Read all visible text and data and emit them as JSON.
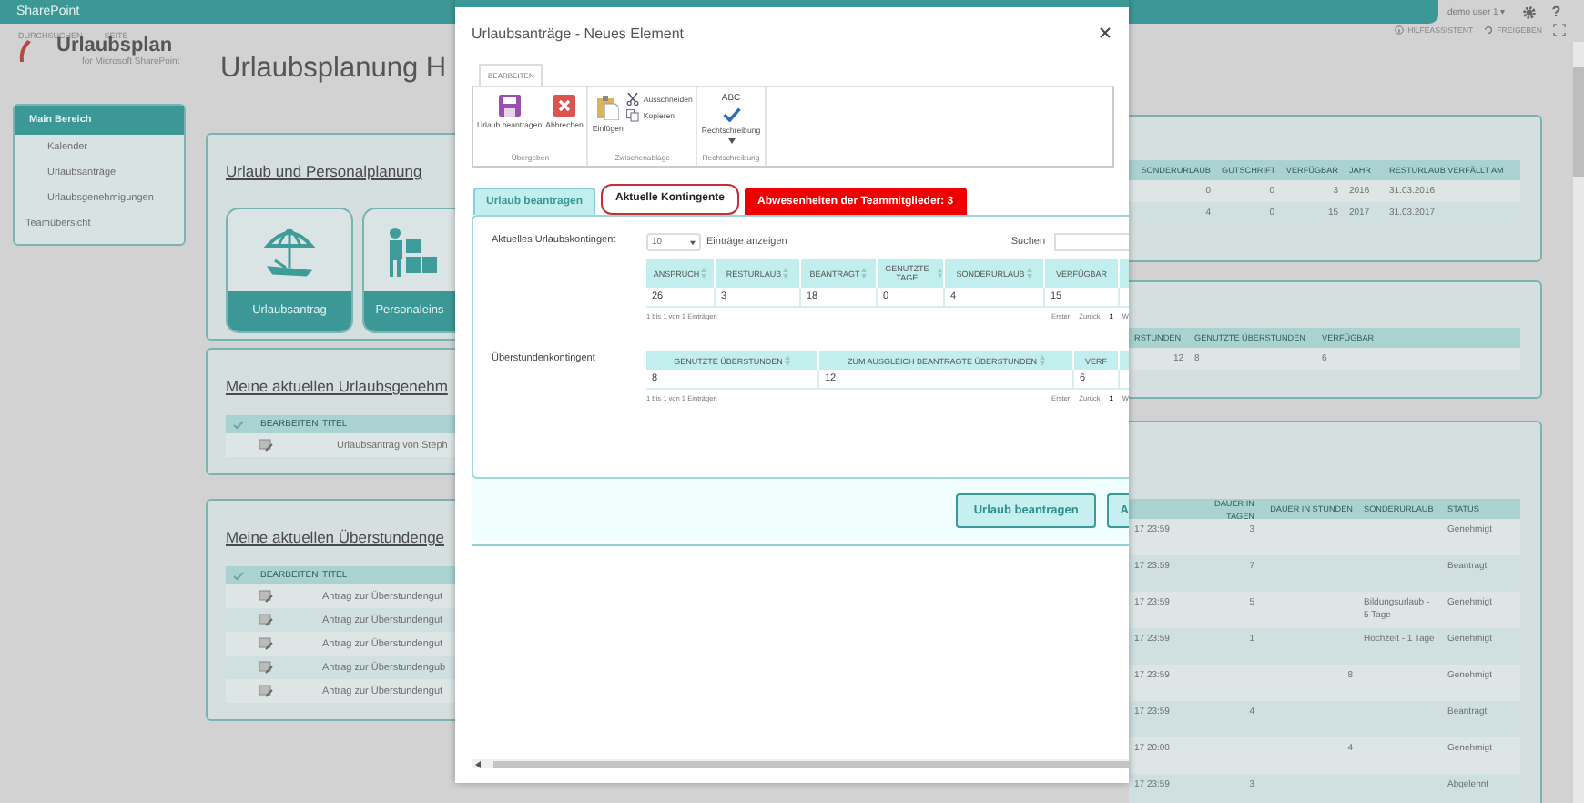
{
  "top_bar": {
    "brand": "SharePoint",
    "user": "demo user 1 ▾",
    "help": "?"
  },
  "sub_bar": {
    "links": [
      "DURCHSUCHEN",
      "SEITE"
    ],
    "actions": [
      {
        "label": "HILFEASSISTENT",
        "kind": "info"
      },
      {
        "label": "FREIGEBEN",
        "kind": "share"
      }
    ]
  },
  "logo": {
    "name": "Urlaubsplan",
    "subtitle": "for Microsoft SharePoint"
  },
  "page_title": "Urlaubsplanung H",
  "nav": {
    "items": [
      {
        "label": "Main Bereich",
        "selected": true,
        "children": [
          {
            "label": "Kalender",
            "selected": false
          },
          {
            "label": "Urlaubsanträge",
            "selected": false
          },
          {
            "label": "Urlaubsgenehmigungen",
            "selected": false
          }
        ]
      },
      {
        "label": "Teamübersicht",
        "selected": false
      }
    ]
  },
  "planning": {
    "title": "Urlaub und Personalplanung",
    "tiles": [
      {
        "label": "Urlaubsantrag",
        "kind": "vacation"
      },
      {
        "label": "Personaleins",
        "kind": "staff"
      }
    ]
  },
  "approvals": {
    "title": "Meine aktuellen Urlaubsgenehm",
    "columns": [
      "BEARBEITEN",
      "TITEL"
    ],
    "rows": [
      {
        "title": "Urlaubsantrag von Steph"
      }
    ]
  },
  "overtime": {
    "title": "Meine aktuellen Überstundenge",
    "columns": [
      "BEARBEITEN",
      "TITEL"
    ],
    "rows": [
      {
        "title": "Antrag zur Überstundengut"
      },
      {
        "title": "Antrag zur Überstundengut"
      },
      {
        "title": "Antrag zur Überstundengut"
      },
      {
        "title": "Antrag zur Überstundengub"
      },
      {
        "title": "Antrag zur Überstundengut"
      }
    ]
  },
  "balance": {
    "columns": [
      "SONDERURLAUB",
      "GUTSCHRIFT",
      "VERFÜGBAR",
      "JAHR",
      "RESTURLAUB VERFÄLLT AM"
    ],
    "rows": [
      [
        "0",
        "0",
        "3",
        "2016",
        "31.03.2016"
      ],
      [
        "4",
        "0",
        "15",
        "2017",
        "31.03.2017"
      ]
    ]
  },
  "overtime_balance": {
    "columns": [
      "RSTUNDEN",
      "GENUTZTE ÜBERSTUNDEN",
      "VERFÜGBAR"
    ],
    "rows": [
      [
        "12",
        "8",
        "6"
      ]
    ]
  },
  "requests": {
    "columns": [
      "",
      "DAUER IN TAGEN",
      "DAUER IN STUNDEN",
      "SONDERURLAUB",
      "STATUS"
    ],
    "rows": [
      [
        "17 23:59",
        "3",
        "",
        "",
        "Genehmigt"
      ],
      [
        "17 23:59",
        "7",
        "",
        "",
        "Beantragt"
      ],
      [
        "17 23:59",
        "5",
        "",
        "Bildungsurlaub - 5 Tage",
        "Genehmigt"
      ],
      [
        "17 23:59",
        "1",
        "",
        "Hochzeit - 1 Tage",
        "Genehmigt"
      ],
      [
        "17 23:59",
        "",
        "8",
        "",
        "Genehmigt"
      ],
      [
        "17 23:59",
        "4",
        "",
        "",
        "Beantragt"
      ],
      [
        "17 20:00",
        "",
        "4",
        "",
        "Genehmigt"
      ],
      [
        "17 23:59",
        "3",
        "",
        "",
        "Abgelehnt"
      ]
    ]
  },
  "dialog": {
    "title": "Urlaubsanträge - Neues Element",
    "ribbon_tab": "BEARBEITEN",
    "ribbon_groups": [
      {
        "label": "Übergeben",
        "commands": [
          {
            "label": "Urlaub beantragen",
            "kind": "save"
          },
          {
            "label": "Abbrechen",
            "kind": "cancel"
          }
        ]
      },
      {
        "label": "Zwischenablage",
        "commands": [
          {
            "label": "Einfügen",
            "kind": "paste"
          },
          {
            "label": "Ausschneiden",
            "kind": "cut"
          },
          {
            "label": "Kopieren",
            "kind": "copy"
          }
        ]
      },
      {
        "label": "Rechtschreibung",
        "commands": [
          {
            "label": "Rechtschreibung",
            "kind": "spell",
            "icon_text": "ABC"
          }
        ]
      }
    ],
    "tabs": [
      {
        "label": "Urlaub beantragen",
        "selected": false,
        "kind": "normal"
      },
      {
        "label": "Aktuelle Kontingente",
        "selected": true,
        "kind": "normal"
      },
      {
        "label": "Abwesenheiten der Teammitglieder: 3",
        "selected": false,
        "kind": "alert"
      }
    ],
    "sections": [
      {
        "label": "Aktuelles Urlaubskontingent",
        "controls": {
          "page_size": "10",
          "page_size_suffix": "Einträge anzeigen",
          "search_label": "Suchen"
        },
        "columns": [
          "ANSPRUCH",
          "RESTURLAUB",
          "BEANTRAGT",
          "GENUTZTE TAGE",
          "SONDERURLAUB",
          "VERFÜGBAR"
        ],
        "rows": [
          [
            "26",
            "3",
            "18",
            "0",
            "4",
            "15"
          ]
        ],
        "info": "1 bis 1 von 1 Einträgen",
        "pager": [
          "Erster",
          "Zurück",
          "1",
          "W"
        ]
      },
      {
        "label": "Überstundenkontingent",
        "columns": [
          "GENUTZTE ÜBERSTUNDEN",
          "ZUM AUSGLEICH BEANTRAGTE ÜBERSTUNDEN",
          "VERF"
        ],
        "rows": [
          [
            "8",
            "12",
            "6"
          ]
        ],
        "info": "1 bis 1 von 1 Einträgen",
        "pager": [
          "Erster",
          "Zurück",
          "1",
          "W"
        ]
      }
    ],
    "buttons": [
      "Urlaub beantragen",
      "A"
    ]
  }
}
